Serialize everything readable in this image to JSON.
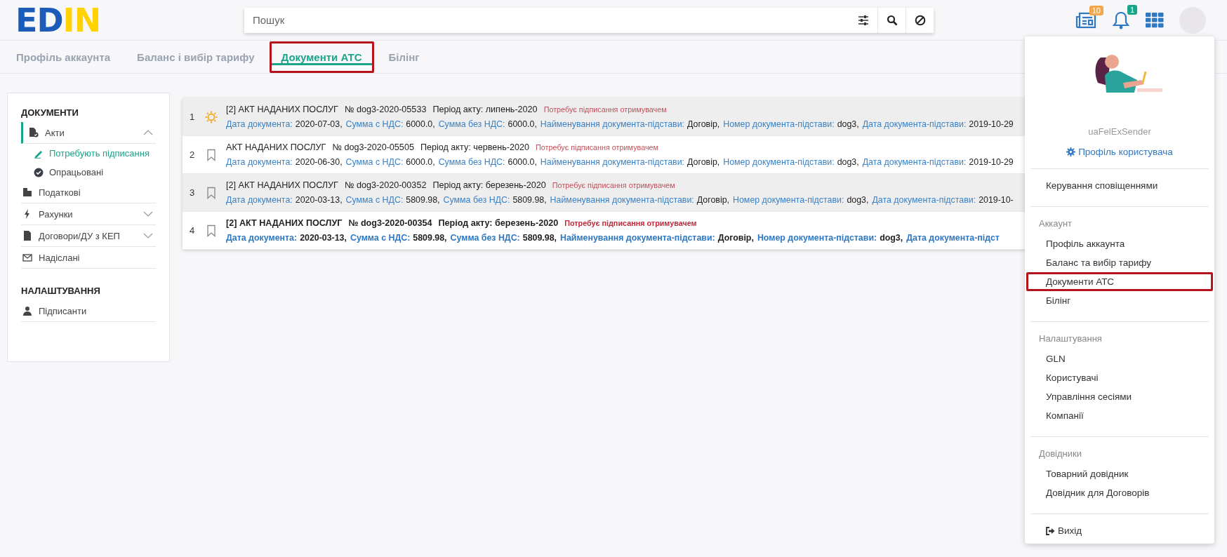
{
  "logo_parts": [
    "ED",
    "IN"
  ],
  "search": {
    "placeholder": "Пошук"
  },
  "header_badges": [
    {
      "kind": "news",
      "count": "10"
    },
    {
      "kind": "bell",
      "count": "1"
    }
  ],
  "tabs": [
    {
      "label": "Профіль аккаунта",
      "selected": false,
      "highlighted": false
    },
    {
      "label": "Баланс і вибір тарифу",
      "selected": false,
      "highlighted": false
    },
    {
      "label": "Документи АТС",
      "selected": true,
      "highlighted": true
    },
    {
      "label": "Білінг",
      "selected": false,
      "highlighted": false
    }
  ],
  "sidebar": {
    "sections": [
      {
        "heading": "ДОКУМЕНТИ",
        "items": [
          {
            "label": "Акти",
            "selected": true,
            "expanded": true,
            "children": [
              {
                "label": "Потребують підписання",
                "selected": true
              },
              {
                "label": "Опрацьовані",
                "selected": false
              }
            ]
          },
          {
            "label": "Податкові",
            "selected": false
          },
          {
            "label": "Рахунки",
            "selected": false,
            "expanded": false
          },
          {
            "label": "Договори/ДУ з КЕП",
            "selected": false,
            "expanded": false
          },
          {
            "label": "Надіслані",
            "selected": false
          }
        ]
      },
      {
        "heading": "НАЛАШТУВАННЯ",
        "items": [
          {
            "label": "Підписанти",
            "selected": false
          }
        ]
      }
    ]
  },
  "documents": [
    {
      "index": "1",
      "kind": "sun",
      "unread": false,
      "title": "[2] АКТ НАДАНИХ ПОСЛУГ",
      "number": "№ dog3-2020-05533",
      "period": "Період акту: липень-2020",
      "status": "Потребує підписання отримувачем",
      "fields": [
        {
          "label": "Дата документа:",
          "value": "2020-07-03,"
        },
        {
          "label": "Сумма с НДС:",
          "value": "6000.0,"
        },
        {
          "label": "Сумма без НДС:",
          "value": "6000.0,"
        },
        {
          "label": "Найменування документа-підстави:",
          "value": "Договір,"
        },
        {
          "label": "Номер документа-підстави:",
          "value": "dog3,"
        },
        {
          "label": "Дата документа-підстави:",
          "value": "2019-10-29"
        }
      ]
    },
    {
      "index": "2",
      "kind": "bookmark",
      "unread": false,
      "title": "АКТ НАДАНИХ ПОСЛУГ",
      "number": "№ dog3-2020-05505",
      "period": "Період акту: червень-2020",
      "status": "Потребує підписання отримувачем",
      "fields": [
        {
          "label": "Дата документа:",
          "value": "2020-06-30,"
        },
        {
          "label": "Сумма с НДС:",
          "value": "6000.0,"
        },
        {
          "label": "Сумма без НДС:",
          "value": "6000.0,"
        },
        {
          "label": "Найменування документа-підстави:",
          "value": "Договір,"
        },
        {
          "label": "Номер документа-підстави:",
          "value": "dog3,"
        },
        {
          "label": "Дата документа-підстави:",
          "value": "2019-10-29"
        }
      ]
    },
    {
      "index": "3",
      "kind": "bookmark",
      "unread": false,
      "title": "[2] АКТ НАДАНИХ ПОСЛУГ",
      "number": "№ dog3-2020-00352",
      "period": "Період акту: березень-2020",
      "status": "Потребує підписання отримувачем",
      "fields": [
        {
          "label": "Дата документа:",
          "value": "2020-03-13,"
        },
        {
          "label": "Сумма с НДС:",
          "value": "5809.98,"
        },
        {
          "label": "Сумма без НДС:",
          "value": "5809.98,"
        },
        {
          "label": "Найменування документа-підстави:",
          "value": "Договір,"
        },
        {
          "label": "Номер документа-підстави:",
          "value": "dog3,"
        },
        {
          "label": "Дата документа-підстави:",
          "value": "2019-10-"
        }
      ]
    },
    {
      "index": "4",
      "kind": "bookmark",
      "unread": true,
      "title": "[2] АКТ НАДАНИХ ПОСЛУГ",
      "number": "№ dog3-2020-00354",
      "period": "Період акту: березень-2020",
      "status": "Потребує підписання отримувачем",
      "fields": [
        {
          "label": "Дата документа:",
          "value": "2020-03-13,"
        },
        {
          "label": "Сумма с НДС:",
          "value": "5809.98,"
        },
        {
          "label": "Сумма без НДС:",
          "value": "5809.98,"
        },
        {
          "label": "Найменування документа-підстави:",
          "value": "Договір,"
        },
        {
          "label": "Номер документа-підстави:",
          "value": "dog3,"
        },
        {
          "label": "Дата документа-підст"
        }
      ]
    }
  ],
  "user_menu": {
    "username": "uaFelExSender",
    "profile_link": "Профіль користувача",
    "sections": [
      {
        "items": [
          {
            "label": "Керування сповіщеннями",
            "highlighted": false
          }
        ]
      },
      {
        "heading": "Аккаунт",
        "items": [
          {
            "label": "Профіль аккаунта",
            "highlighted": false
          },
          {
            "label": "Баланс та вибір тарифу",
            "highlighted": false
          },
          {
            "label": "Документи АТС",
            "highlighted": true
          },
          {
            "label": "Білінг",
            "highlighted": false
          }
        ]
      },
      {
        "heading": "Налаштування",
        "items": [
          {
            "label": "GLN",
            "highlighted": false
          },
          {
            "label": "Користувачі",
            "highlighted": false
          },
          {
            "label": "Управління сесіями",
            "highlighted": false
          },
          {
            "label": "Компанії",
            "highlighted": false
          }
        ]
      },
      {
        "heading": "Довідники",
        "items": [
          {
            "label": "Товарний довідник",
            "highlighted": false
          },
          {
            "label": "Довідник для Договорів",
            "highlighted": false
          }
        ]
      }
    ],
    "logout": "Вихід"
  }
}
